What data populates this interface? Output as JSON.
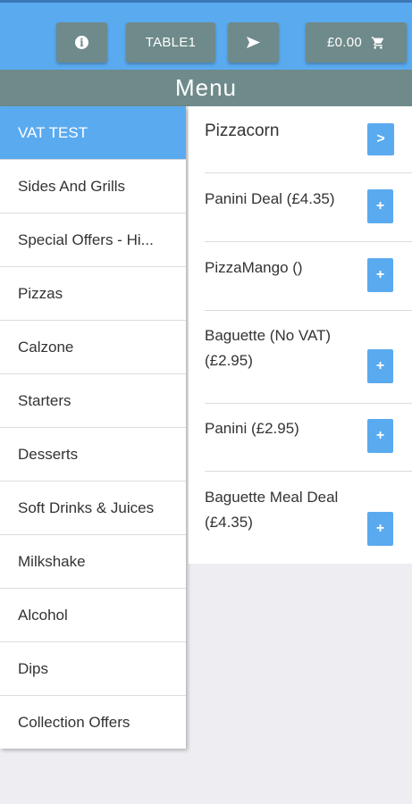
{
  "header": {
    "table_label": "TABLE1",
    "cart_total": "£0.00",
    "menu_title": "Menu"
  },
  "categories": [
    {
      "label": "VAT TEST",
      "active": true
    },
    {
      "label": "Sides And Grills"
    },
    {
      "label": "Special Offers - Hi..."
    },
    {
      "label": "Pizzas"
    },
    {
      "label": "Calzone"
    },
    {
      "label": "Starters"
    },
    {
      "label": "Desserts"
    },
    {
      "label": "Soft Drinks & Juices"
    },
    {
      "label": "Milkshake"
    },
    {
      "label": "Alcohol"
    },
    {
      "label": "Dips"
    },
    {
      "label": "Collection Offers"
    }
  ],
  "products": [
    {
      "name": "Pizzacorn",
      "button": ">"
    },
    {
      "name": "Panini Deal (£4.35)",
      "button": "+"
    },
    {
      "name": "PizzaMango ()",
      "button": "+"
    },
    {
      "name": "Baguette (No VAT) (£2.95)",
      "button": "+"
    },
    {
      "name": "Panini (£2.95)",
      "button": "+"
    },
    {
      "name": "Baguette Meal Deal (£4.35)",
      "button": "+"
    }
  ],
  "icons": {
    "info": "info-icon",
    "send": "send-icon",
    "cart": "cart-icon"
  },
  "colors": {
    "accent_blue": "#5aaaf0",
    "header_grey": "#6f8a8a"
  }
}
